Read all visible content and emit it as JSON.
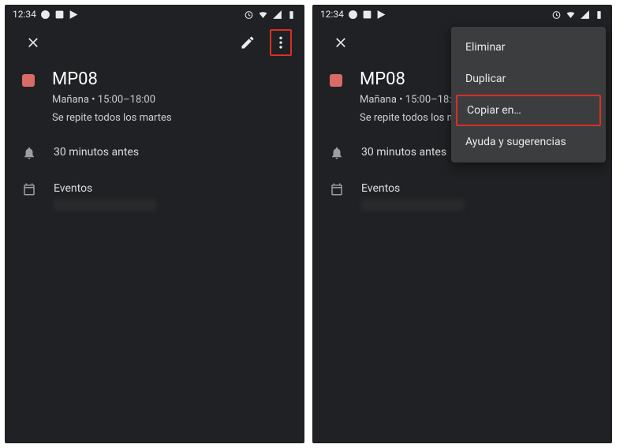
{
  "status": {
    "time": "12:34"
  },
  "event": {
    "title": "MP08",
    "datetime": "Mañana  •  15:00–18:00",
    "recurrence": "Se repite todos los martes"
  },
  "reminder": {
    "label": "30 minutos antes"
  },
  "calendar": {
    "label": "Eventos"
  },
  "menu": {
    "delete": "Eliminar",
    "duplicate": "Duplicar",
    "copy_to": "Copiar en…",
    "help": "Ayuda y sugerencias"
  }
}
